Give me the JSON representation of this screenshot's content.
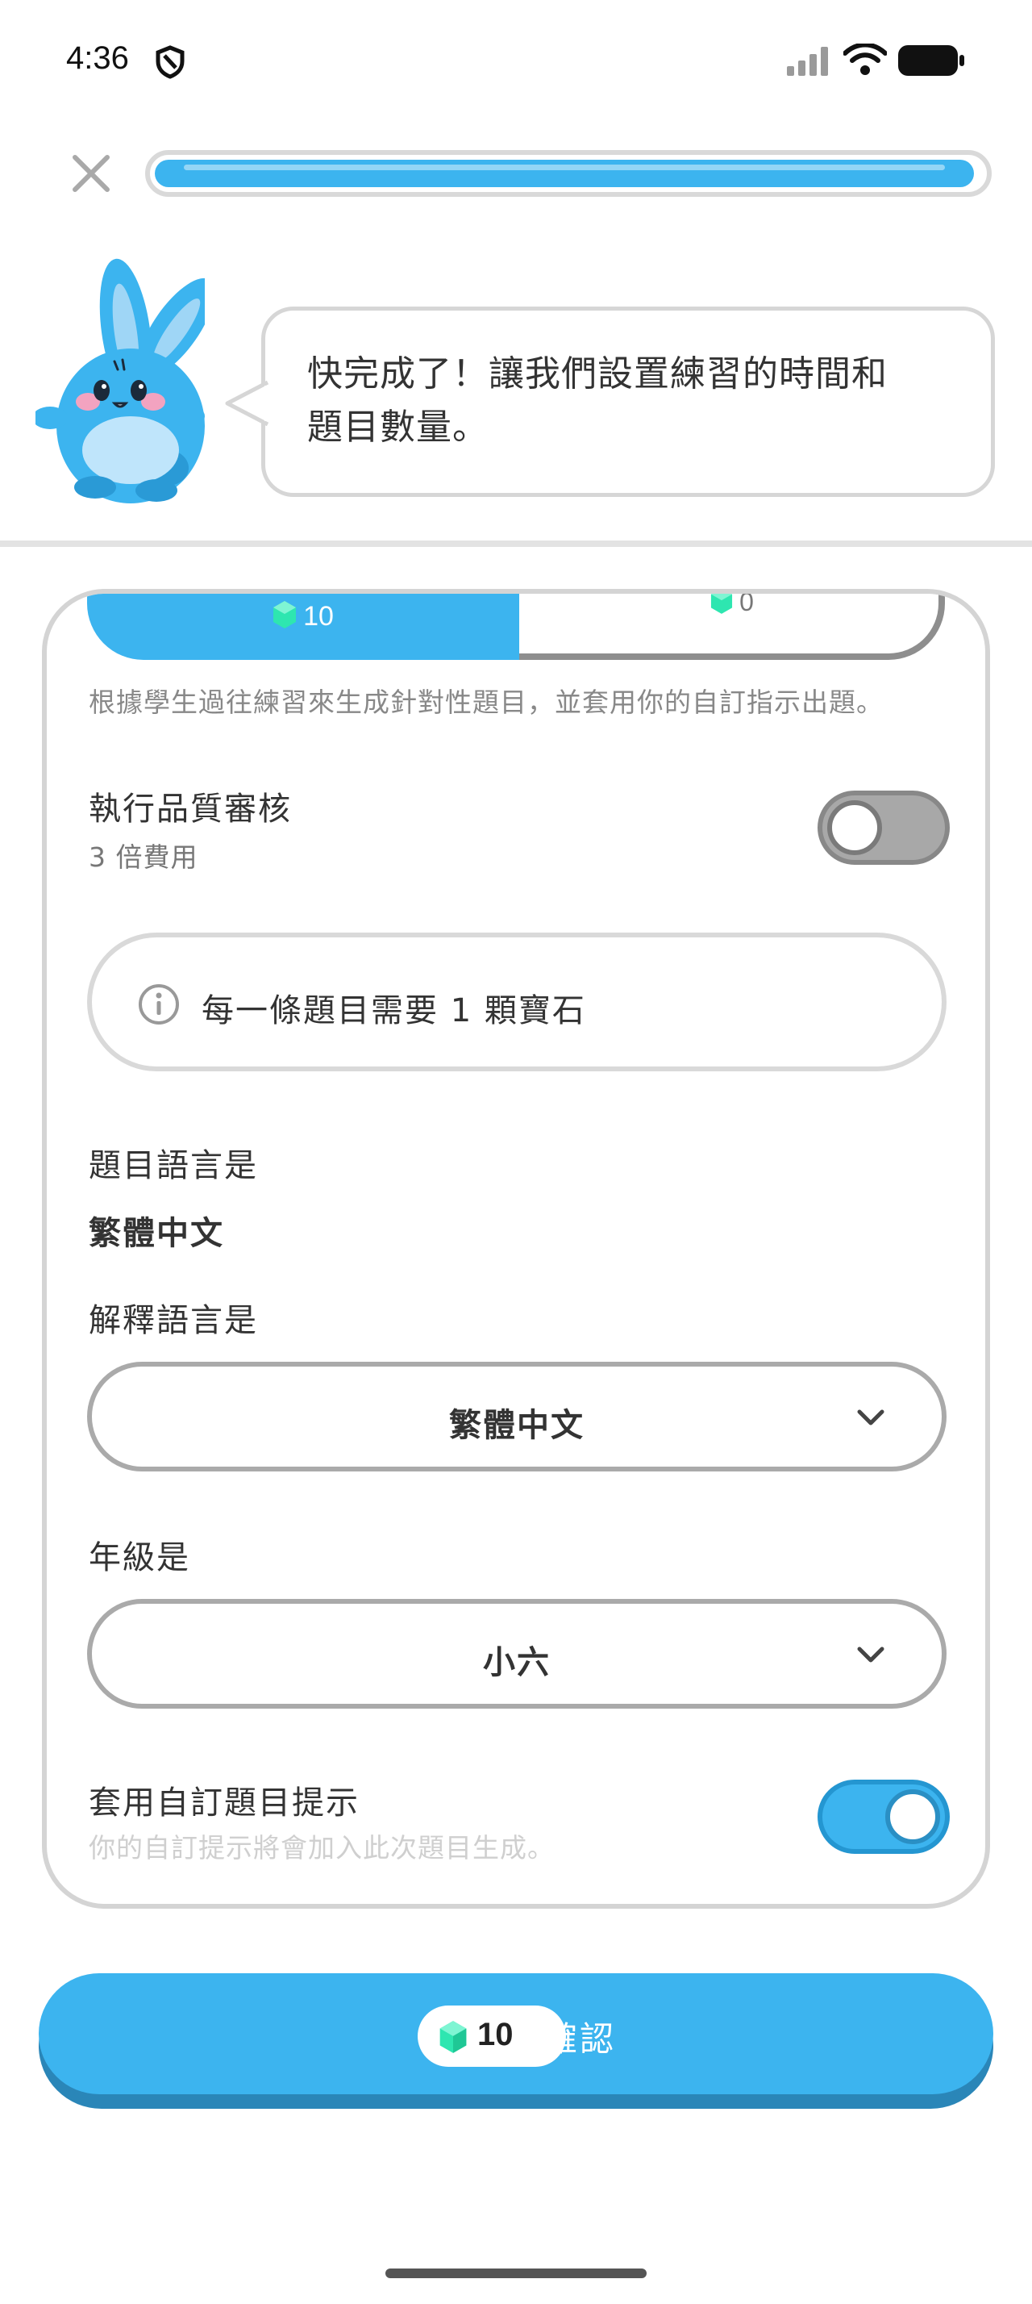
{
  "status_bar": {
    "time": "4:36",
    "shield_icon": "shield-icon",
    "signal_icon": "signal-icon",
    "wifi_icon": "wifi-icon",
    "battery_icon": "battery-icon"
  },
  "header": {
    "close_icon": "close-icon",
    "progress": 0.99
  },
  "speech": {
    "line1": "快完成了！讓我們設置練習的時間和",
    "line2": "題目數量。"
  },
  "segments": {
    "left_gems": "10",
    "right_gems": "0"
  },
  "description": "根據學生過往練習來生成針對性題目，並套用你的自訂指示出題。",
  "quality_review": {
    "title": "執行品質審核",
    "subtitle": "3 倍費用",
    "enabled": false
  },
  "info": {
    "icon": "info-icon",
    "text": "每一條題目需要 1 顆寶石"
  },
  "question_language": {
    "label": "題目語言是",
    "value": "繁體中文"
  },
  "explanation_language": {
    "label": "解釋語言是",
    "value": "繁體中文"
  },
  "grade": {
    "label": "年級是",
    "value": "小六"
  },
  "custom_prompt": {
    "title": "套用自訂題目提示",
    "subtitle": "你的自訂提示將會加入此次題目生成。",
    "enabled": true
  },
  "confirm": {
    "gems": "10",
    "label": "確認"
  },
  "colors": {
    "accent": "#3cb4ef",
    "gem": "#2ee6b0",
    "toggle_off": "#a8a8a8"
  }
}
